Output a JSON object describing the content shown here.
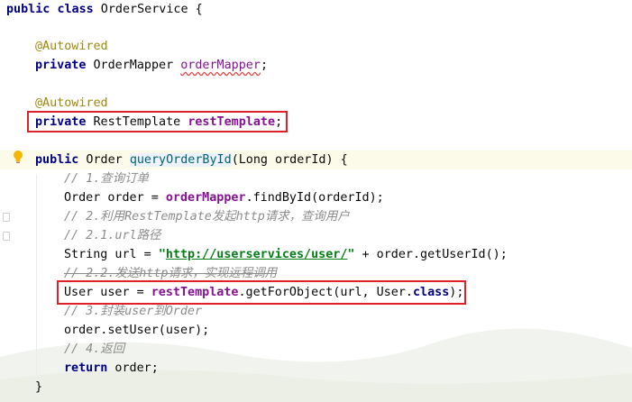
{
  "code": {
    "line1": {
      "kw1": "public",
      "kw2": "class",
      "name": " OrderService {"
    },
    "line3": {
      "annotation": "@Autowired"
    },
    "line4": {
      "kw": "private",
      "type": " OrderMapper ",
      "field": "orderMapper",
      "end": ";"
    },
    "line6": {
      "annotation": "@Autowired"
    },
    "line7": {
      "kw": "private",
      "type": " RestTemplate ",
      "field": "restTemplate",
      "end": ";"
    },
    "line9": {
      "kw": "public",
      "type": " Order ",
      "method": "queryOrderById",
      "params": "(Long orderId) {"
    },
    "line10": {
      "comment": "// 1.查询订单"
    },
    "line11": {
      "start": "Order order = ",
      "field": "orderMapper",
      "rest": ".findById(orderId);"
    },
    "line12": {
      "comment": "// 2.利用RestTemplate发起http请求，查询用户"
    },
    "line13": {
      "comment": "// 2.1.url路径"
    },
    "line14": {
      "start": "String url = ",
      "quote_open": "\"",
      "url": "http://userservices/user/",
      "quote_close": "\"",
      "rest": " + order.getUserId();"
    },
    "line15": {
      "comment": "// 2.2.发送http请求，实现远程调用"
    },
    "line16": {
      "start": "User user = ",
      "field": "restTemplate",
      "mid": ".getForObject(url, User.",
      "kw": "class",
      "end": ");"
    },
    "line17": {
      "comment": "// 3.封装user到Order"
    },
    "line18": {
      "code": "order.setUser(user);"
    },
    "line19": {
      "comment": "// 4.返回"
    },
    "line20": {
      "kw": "return",
      "rest": " order;"
    },
    "line21": {
      "code": "}"
    }
  },
  "colors": {
    "highlight_box": "#e0202a",
    "keyword": "#0033b3",
    "annotation": "#9e880d",
    "field": "#871094",
    "comment": "#8c8c8c",
    "string": "#067d17"
  },
  "icons": {
    "gutter_intention": "lightbulb-icon"
  }
}
